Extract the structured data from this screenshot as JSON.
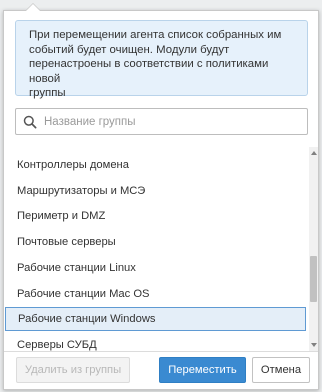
{
  "info": {
    "line1": "При перемещении агента список собранных им",
    "line2": "событий будет очищен. Модули будут",
    "line3": "перенастроены в соответствии с политиками новой",
    "line4": "группы"
  },
  "search": {
    "placeholder": "Название группы",
    "value": ""
  },
  "groups": [
    "Контроллеры домена",
    "Маршрутизаторы и МСЭ",
    "Периметр и DMZ",
    "Почтовые серверы",
    "Рабочие станции Linux",
    "Рабочие станции Mac OS",
    "Рабочие станции Windows",
    "Серверы СУБД"
  ],
  "selected_group": "Рабочие станции Windows",
  "scroll_position": 0.72,
  "buttons": {
    "remove": "Удалить из группы",
    "remove_enabled": false,
    "move": "Переместить",
    "cancel": "Отмена"
  },
  "colors": {
    "accent": "#3a8ad1",
    "info_bg": "#e6f1fb",
    "selected_bg": "#e4eef8",
    "selected_border": "#5f9ad3"
  },
  "icons": {
    "search": "search-icon",
    "scroll_up": "chevron-up-icon",
    "scroll_down": "chevron-down-icon"
  }
}
